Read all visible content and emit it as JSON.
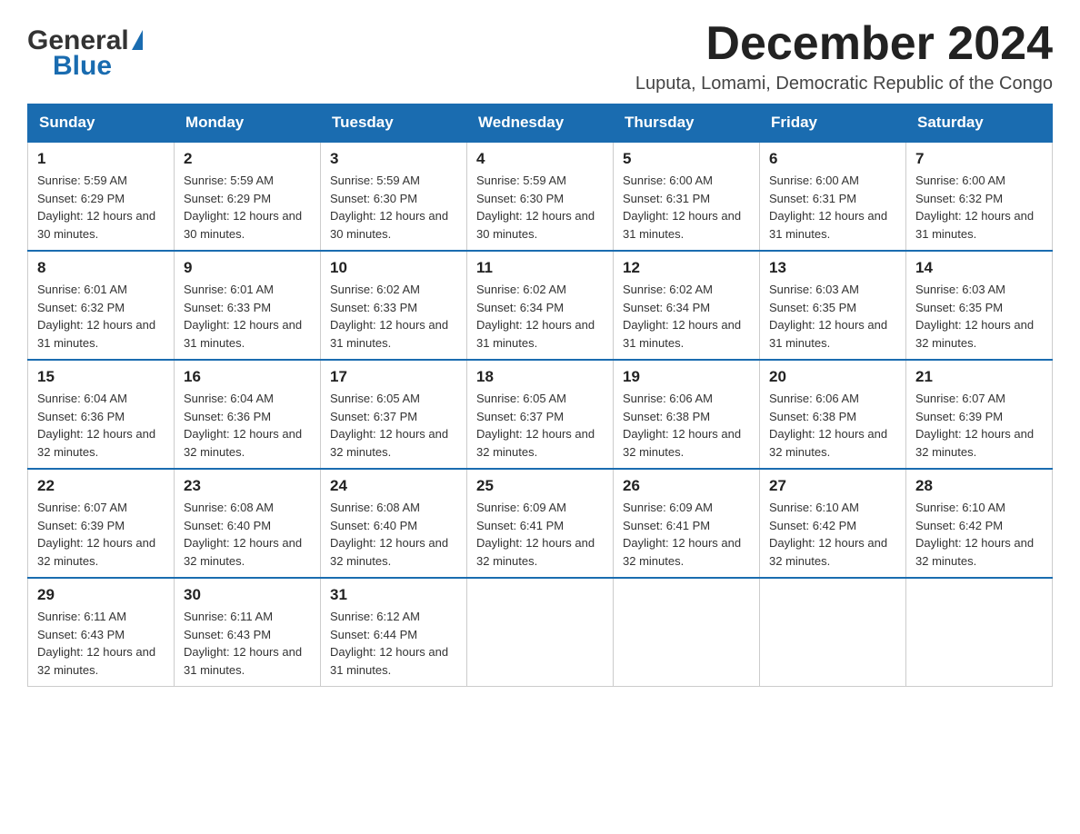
{
  "logo": {
    "general": "General",
    "blue": "Blue",
    "triangle": "▲"
  },
  "title": "December 2024",
  "subtitle": "Luputa, Lomami, Democratic Republic of the Congo",
  "days_of_week": [
    "Sunday",
    "Monday",
    "Tuesday",
    "Wednesday",
    "Thursday",
    "Friday",
    "Saturday"
  ],
  "weeks": [
    [
      {
        "day": "1",
        "sunrise": "5:59 AM",
        "sunset": "6:29 PM",
        "daylight": "12 hours and 30 minutes."
      },
      {
        "day": "2",
        "sunrise": "5:59 AM",
        "sunset": "6:29 PM",
        "daylight": "12 hours and 30 minutes."
      },
      {
        "day": "3",
        "sunrise": "5:59 AM",
        "sunset": "6:30 PM",
        "daylight": "12 hours and 30 minutes."
      },
      {
        "day": "4",
        "sunrise": "5:59 AM",
        "sunset": "6:30 PM",
        "daylight": "12 hours and 30 minutes."
      },
      {
        "day": "5",
        "sunrise": "6:00 AM",
        "sunset": "6:31 PM",
        "daylight": "12 hours and 31 minutes."
      },
      {
        "day": "6",
        "sunrise": "6:00 AM",
        "sunset": "6:31 PM",
        "daylight": "12 hours and 31 minutes."
      },
      {
        "day": "7",
        "sunrise": "6:00 AM",
        "sunset": "6:32 PM",
        "daylight": "12 hours and 31 minutes."
      }
    ],
    [
      {
        "day": "8",
        "sunrise": "6:01 AM",
        "sunset": "6:32 PM",
        "daylight": "12 hours and 31 minutes."
      },
      {
        "day": "9",
        "sunrise": "6:01 AM",
        "sunset": "6:33 PM",
        "daylight": "12 hours and 31 minutes."
      },
      {
        "day": "10",
        "sunrise": "6:02 AM",
        "sunset": "6:33 PM",
        "daylight": "12 hours and 31 minutes."
      },
      {
        "day": "11",
        "sunrise": "6:02 AM",
        "sunset": "6:34 PM",
        "daylight": "12 hours and 31 minutes."
      },
      {
        "day": "12",
        "sunrise": "6:02 AM",
        "sunset": "6:34 PM",
        "daylight": "12 hours and 31 minutes."
      },
      {
        "day": "13",
        "sunrise": "6:03 AM",
        "sunset": "6:35 PM",
        "daylight": "12 hours and 31 minutes."
      },
      {
        "day": "14",
        "sunrise": "6:03 AM",
        "sunset": "6:35 PM",
        "daylight": "12 hours and 32 minutes."
      }
    ],
    [
      {
        "day": "15",
        "sunrise": "6:04 AM",
        "sunset": "6:36 PM",
        "daylight": "12 hours and 32 minutes."
      },
      {
        "day": "16",
        "sunrise": "6:04 AM",
        "sunset": "6:36 PM",
        "daylight": "12 hours and 32 minutes."
      },
      {
        "day": "17",
        "sunrise": "6:05 AM",
        "sunset": "6:37 PM",
        "daylight": "12 hours and 32 minutes."
      },
      {
        "day": "18",
        "sunrise": "6:05 AM",
        "sunset": "6:37 PM",
        "daylight": "12 hours and 32 minutes."
      },
      {
        "day": "19",
        "sunrise": "6:06 AM",
        "sunset": "6:38 PM",
        "daylight": "12 hours and 32 minutes."
      },
      {
        "day": "20",
        "sunrise": "6:06 AM",
        "sunset": "6:38 PM",
        "daylight": "12 hours and 32 minutes."
      },
      {
        "day": "21",
        "sunrise": "6:07 AM",
        "sunset": "6:39 PM",
        "daylight": "12 hours and 32 minutes."
      }
    ],
    [
      {
        "day": "22",
        "sunrise": "6:07 AM",
        "sunset": "6:39 PM",
        "daylight": "12 hours and 32 minutes."
      },
      {
        "day": "23",
        "sunrise": "6:08 AM",
        "sunset": "6:40 PM",
        "daylight": "12 hours and 32 minutes."
      },
      {
        "day": "24",
        "sunrise": "6:08 AM",
        "sunset": "6:40 PM",
        "daylight": "12 hours and 32 minutes."
      },
      {
        "day": "25",
        "sunrise": "6:09 AM",
        "sunset": "6:41 PM",
        "daylight": "12 hours and 32 minutes."
      },
      {
        "day": "26",
        "sunrise": "6:09 AM",
        "sunset": "6:41 PM",
        "daylight": "12 hours and 32 minutes."
      },
      {
        "day": "27",
        "sunrise": "6:10 AM",
        "sunset": "6:42 PM",
        "daylight": "12 hours and 32 minutes."
      },
      {
        "day": "28",
        "sunrise": "6:10 AM",
        "sunset": "6:42 PM",
        "daylight": "12 hours and 32 minutes."
      }
    ],
    [
      {
        "day": "29",
        "sunrise": "6:11 AM",
        "sunset": "6:43 PM",
        "daylight": "12 hours and 32 minutes."
      },
      {
        "day": "30",
        "sunrise": "6:11 AM",
        "sunset": "6:43 PM",
        "daylight": "12 hours and 31 minutes."
      },
      {
        "day": "31",
        "sunrise": "6:12 AM",
        "sunset": "6:44 PM",
        "daylight": "12 hours and 31 minutes."
      },
      null,
      null,
      null,
      null
    ]
  ],
  "labels": {
    "sunrise": "Sunrise:",
    "sunset": "Sunset:",
    "daylight": "Daylight:"
  }
}
